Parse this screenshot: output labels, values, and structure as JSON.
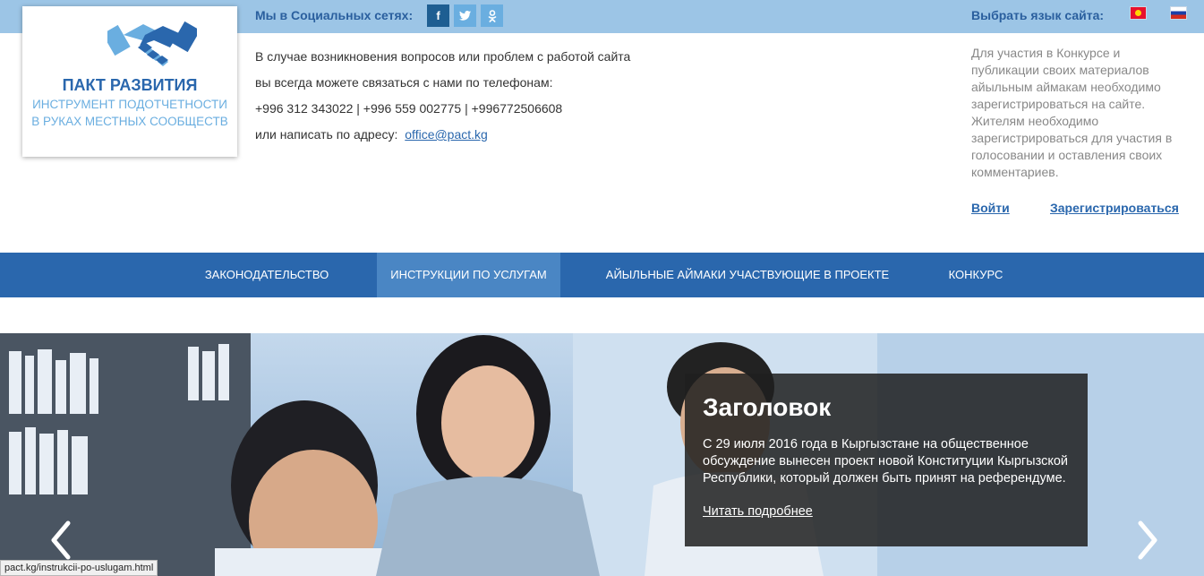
{
  "top_bar": {
    "social_label": "Мы в Социальных сетях:",
    "social_icons": [
      {
        "name": "facebook-icon",
        "glyph": "f"
      },
      {
        "name": "twitter-icon",
        "glyph": "t"
      },
      {
        "name": "odnoklassniki-icon",
        "glyph": "8"
      }
    ],
    "language_label": "Выбрать язык сайта:",
    "languages": [
      "kyrgyz-flag-icon",
      "russian-flag-icon"
    ]
  },
  "logo": {
    "title": "ПАКТ РАЗВИТИЯ",
    "subtitle": "ИНСТРУМЕНТ ПОДОТЧЕТНОСТИ В РУКАХ МЕСТНЫХ СООБЩЕСТВ",
    "icon": "handshake-icon"
  },
  "contact": {
    "line1": "В случае возникновения вопросов или проблем с работой сайта",
    "line2": "вы всегда можете связаться с нами по телефонам:",
    "phones": "+996 312 343022 | +996 559 002775 | +996772506608",
    "email_prefix": "или написать по адресу:",
    "email": "office@pact.kg"
  },
  "info": {
    "text": "Для участия в Конкурсе и публикации своих материалов айыльным аймакам необходимо зарегистрироваться на сайте. Жителям необходимо зарегистрироваться для участия в голосовании и оставления своих комментариев.",
    "login": "Войти",
    "register": "Зарегистрироваться"
  },
  "nav": {
    "items": [
      {
        "label": "ЗАКОНОДАТЕЛЬСТВО",
        "active": false
      },
      {
        "label": "ИНСТРУКЦИИ ПО УСЛУГАМ",
        "active": true
      },
      {
        "label": "АЙЫЛЬНЫЕ АЙМАКИ УЧАСТВУЮЩИЕ В ПРОЕКТЕ",
        "active": false
      },
      {
        "label": "КОНКУРС",
        "active": false
      }
    ]
  },
  "slider": {
    "title": "Заголовок",
    "text": "С 29 июля 2016 года в Кыргызстане на общественное обсуждение вынесен проект новой Конституции Кыргызской Республики, который должен быть принят на референдуме.",
    "read_more": "Читать подробнее",
    "prev_icon": "chevron-left-icon",
    "next_icon": "chevron-right-icon"
  },
  "status_bar": {
    "url": "pact.kg/instrukcii-po-uslugam.html"
  },
  "colors": {
    "top_strip": "#9cc5e6",
    "brand_blue": "#2a67ad",
    "nav_active": "#4a86c4",
    "caption_bg": "#1e1e1e"
  }
}
